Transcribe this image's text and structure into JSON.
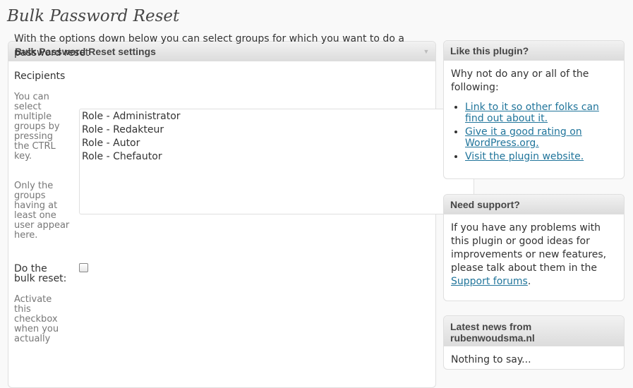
{
  "page": {
    "title": "Bulk Password Reset"
  },
  "main": {
    "box_title": "Bulk Password Reset settings",
    "intro": "With the options down below you can select groups for which you want to do a password reset",
    "recipients_label": "Recipients",
    "help_multi_select": "You can select multiple groups by pressing the CTRL key.",
    "help_only_groups": "Only the groups having at least one user appear here.",
    "roles": [
      "Role - Administrator",
      "Role - Redakteur",
      "Role - Autor",
      "Role - Chefautor"
    ],
    "bulk_reset_label": "Do the bulk reset:",
    "bulk_reset_help": "Activate this checkbox when you actually",
    "bulk_reset_checked": false
  },
  "sidebar": {
    "like": {
      "title": "Like this plugin?",
      "intro": "Why not do any or all of the following:",
      "links": [
        "Link to it so other folks can find out about it.",
        "Give it a good rating on WordPress.org.",
        "Visit the plugin website."
      ]
    },
    "support": {
      "title": "Need support?",
      "text": "If you have any problems with this plugin or good ideas for improvements or new features, please talk about them in the",
      "link": "Support forums",
      "suffix": "."
    },
    "news": {
      "title": "Latest news from rubenwoudsma.nl",
      "text": "Nothing to say..."
    }
  },
  "colors": {
    "link": "#21759b",
    "header_top": "#f2f2f2",
    "header_bottom": "#dcdcdc",
    "border": "#dfdfdf"
  }
}
